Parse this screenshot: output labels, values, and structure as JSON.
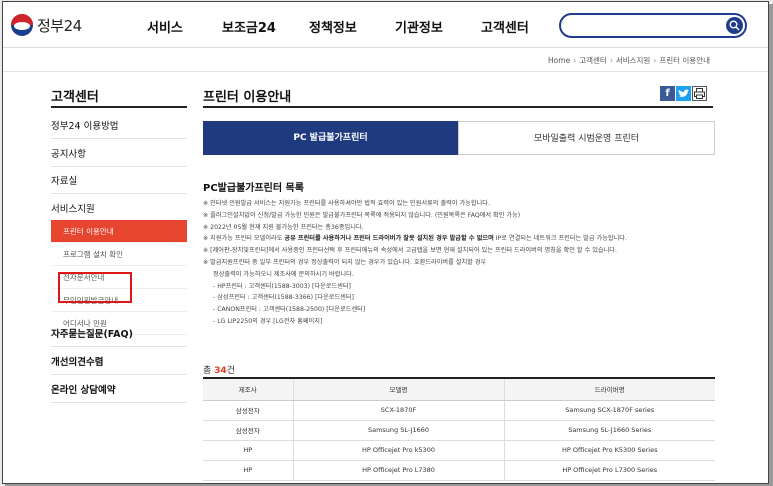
{
  "header": {
    "logo_text": "정부24",
    "nav": [
      "서비스",
      "보조금24",
      "정책정보",
      "기관정보",
      "고객센터"
    ],
    "search_placeholder": ""
  },
  "breadcrumb": [
    "Home",
    "고객센터",
    "서비스지원",
    "프린터 이용안내"
  ],
  "sidebar": {
    "title": "고객센터",
    "items": [
      "정부24 이용방법",
      "공지사항",
      "자료실",
      "서비스지원"
    ],
    "sub_items": [
      "프린터 이용안내",
      "프로그램 설치 확인",
      "전자문서안내",
      "무인민원발급안내",
      "어디서나 민원"
    ],
    "items_after": [
      "자주묻는질문(FAQ)",
      "개선의견수렴",
      "온라인 상담예약"
    ]
  },
  "main": {
    "title": "프린터 이용안내",
    "tabs": [
      "PC 발급불가프린터",
      "모바일출력 시범운영 프린터"
    ],
    "section_title": "PC발급불가프린터 목록",
    "notes": [
      "※ 인터넷 민원발급 서비스는 지원가능 프린터를 사용하셔야만 법적 효력이 있는 민원서류의 출력이 가능합니다.",
      "※ 플러그인설치없이 신청/발급 가능한 민원은 발급불가프린터 목록에 적용되지 않습니다. (민원목록은 FAQ에서 확인 가능)",
      "※ 2022년 05월 현재 지원 불가능한 프린터는 총36종입니다.",
      "※ 지원가능 프린터 모델이라도 공유 프린터를 사용하거나 프린터 드라이버가 잘못 설치된 경우 발급할 수 없으며 IP로 연결되는 네트워크 프린터는 발급 가능합니다.",
      "※ [제어판-장치및프린터]에서 사용중인 프린터선택 후 프린터메뉴의 속성에서 고급탭을 보면 현재 설치되어 있는 프린터 드라이버의 명칭을 확인 할 수 있습니다.",
      "※ 발급지원프린터 중 일부 프린터의 경우 정상출력이 되지 않는 경우가 있습니다. 호환드라이버를 설치할 경우",
      "정상출력이 가능하오니 제조사에 문의하시기 바랍니다.",
      "- HP프린터 : 고객센터(1588-3003) [다운로드센터]",
      "- 삼성프린터 : 고객센터(1588-3366) [다운로드센터]",
      "- CANON프린터 : 고객센터(1588-2500) [다운로드센터]",
      "- LG LIP2250의 경우 [LG전자 홈페이지]"
    ],
    "notes_bold_fragment": "공유 프린터를 사용하거나 프린터 드라이버가 잘못 설치된 경우 발급할 수 없으며",
    "count_prefix": "총 ",
    "count_value": "34",
    "count_suffix": "건",
    "table": {
      "headers": [
        "제조사",
        "모델명",
        "드라이버명"
      ],
      "rows": [
        [
          "삼성전자",
          "SCX-1870F",
          "Samsung SCX-1870F series"
        ],
        [
          "삼성전자",
          "Samsung SL-J1660",
          "Samsung SL-J1660 Series"
        ],
        [
          "HP",
          "HP Officejet Pro k5300",
          "HP Officejet Pro K5300 Series"
        ],
        [
          "HP",
          "HP Officejet Pro L7380",
          "HP Officejet Pro L7300 Series"
        ]
      ]
    }
  },
  "colors": {
    "brand_navy": "#203a80",
    "active_red": "#e8452f",
    "highlight_red": "#e01616"
  }
}
